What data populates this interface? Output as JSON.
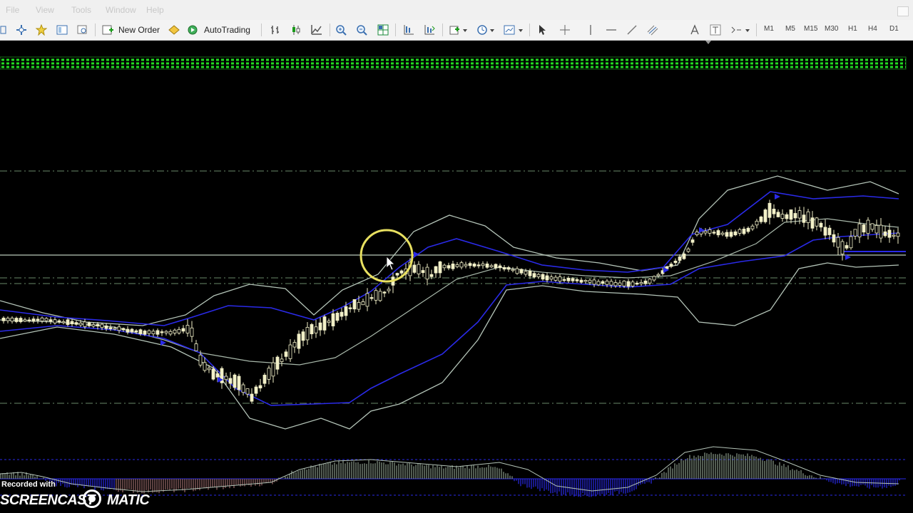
{
  "menu": {
    "items": [
      "File",
      "View",
      "Tools",
      "Window",
      "Help"
    ]
  },
  "toolbar": {
    "new_order_label": "New Order",
    "autotrading_label": "AutoTrading",
    "timeframes": [
      "M1",
      "M5",
      "M15",
      "M30",
      "H1",
      "H4",
      "D1"
    ]
  },
  "colors": {
    "background": "#000000",
    "candle": "#f2f0c8",
    "bollinger": "#b4c4b8",
    "envelope": "#2a2ae8",
    "level_line": "#6a8a6a",
    "histogram_positive": "#8a9a8a",
    "histogram_negative": "#2a2ae8",
    "highlight_circle": "#e8e060"
  },
  "watermark": {
    "line1": "Recorded with",
    "line2": "SCREENCAST",
    "line3": "MATIC"
  }
}
